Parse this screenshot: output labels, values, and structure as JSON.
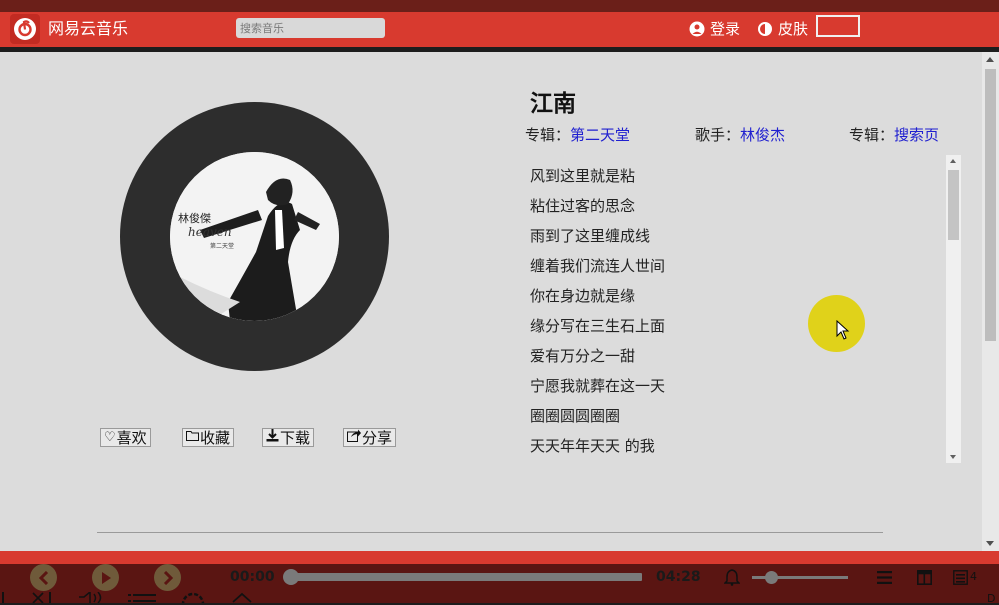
{
  "header": {
    "app_name": "网易云音乐",
    "search_placeholder": "搜索音乐",
    "login_label": "登录",
    "skin_label": "皮肤"
  },
  "song": {
    "title": "江南",
    "album_prefix": "专辑：",
    "album_name": "第二天堂",
    "singer_prefix": "歌手：",
    "singer_name": "林俊杰",
    "source_prefix": "专辑：",
    "source_name": "搜索页",
    "cover_text": "林俊傑 heaven 第二天堂"
  },
  "actions": {
    "like": "喜欢",
    "collect": "收藏",
    "download": "下载",
    "share": "分享"
  },
  "lyrics": [
    "风到这里就是粘",
    "粘住过客的思念",
    "雨到了这里缠成线",
    "缠着我们流连人世间",
    "你在身边就是缘",
    "缘分写在三生石上面",
    "爱有万分之一甜",
    "宁愿我就葬在这一天",
    "圈圈圆圆圈圈",
    "天天年年天天 的我"
  ],
  "player": {
    "current_time": "00:00",
    "total_time": "04:28",
    "progress": 0,
    "volume": 0.2,
    "playlist_count": "4"
  },
  "colors": {
    "header_red": "#d83a2f",
    "player_dark": "#5a1512",
    "link_blue": "#2020d0",
    "disc": "#2d2d2d"
  }
}
